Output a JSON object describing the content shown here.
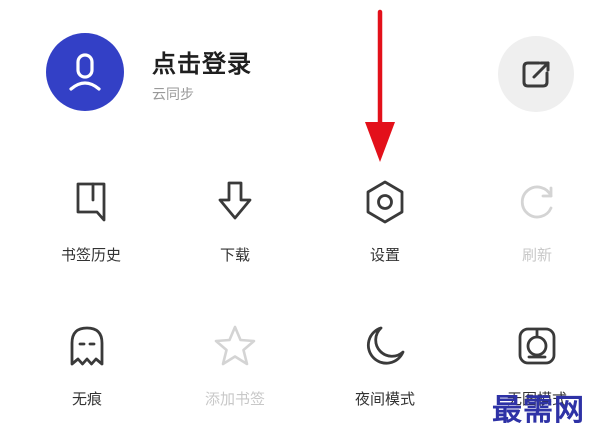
{
  "account": {
    "login_title": "点击登录",
    "subtitle": "云同步"
  },
  "menu": {
    "row1": [
      {
        "label": "书签历史",
        "icon": "bookmark-icon",
        "enabled": true
      },
      {
        "label": "下载",
        "icon": "download-icon",
        "enabled": true
      },
      {
        "label": "设置",
        "icon": "settings-hexagon-icon",
        "enabled": true
      },
      {
        "label": "刷新",
        "icon": "refresh-icon",
        "enabled": false
      }
    ],
    "row2": [
      {
        "label": "无痕",
        "icon": "ghost-icon",
        "enabled": true
      },
      {
        "label": "添加书签",
        "icon": "star-icon",
        "enabled": false
      },
      {
        "label": "夜间模式",
        "icon": "moon-icon",
        "enabled": true
      },
      {
        "label": "无图模式",
        "icon": "no-image-icon",
        "enabled": true
      }
    ]
  },
  "watermark": {
    "text": "最需网"
  },
  "colors": {
    "accent": "#3340c6",
    "annotation_arrow": "#e3101a",
    "disabled": "#c8c8c8",
    "watermark": "#2e32a6"
  }
}
